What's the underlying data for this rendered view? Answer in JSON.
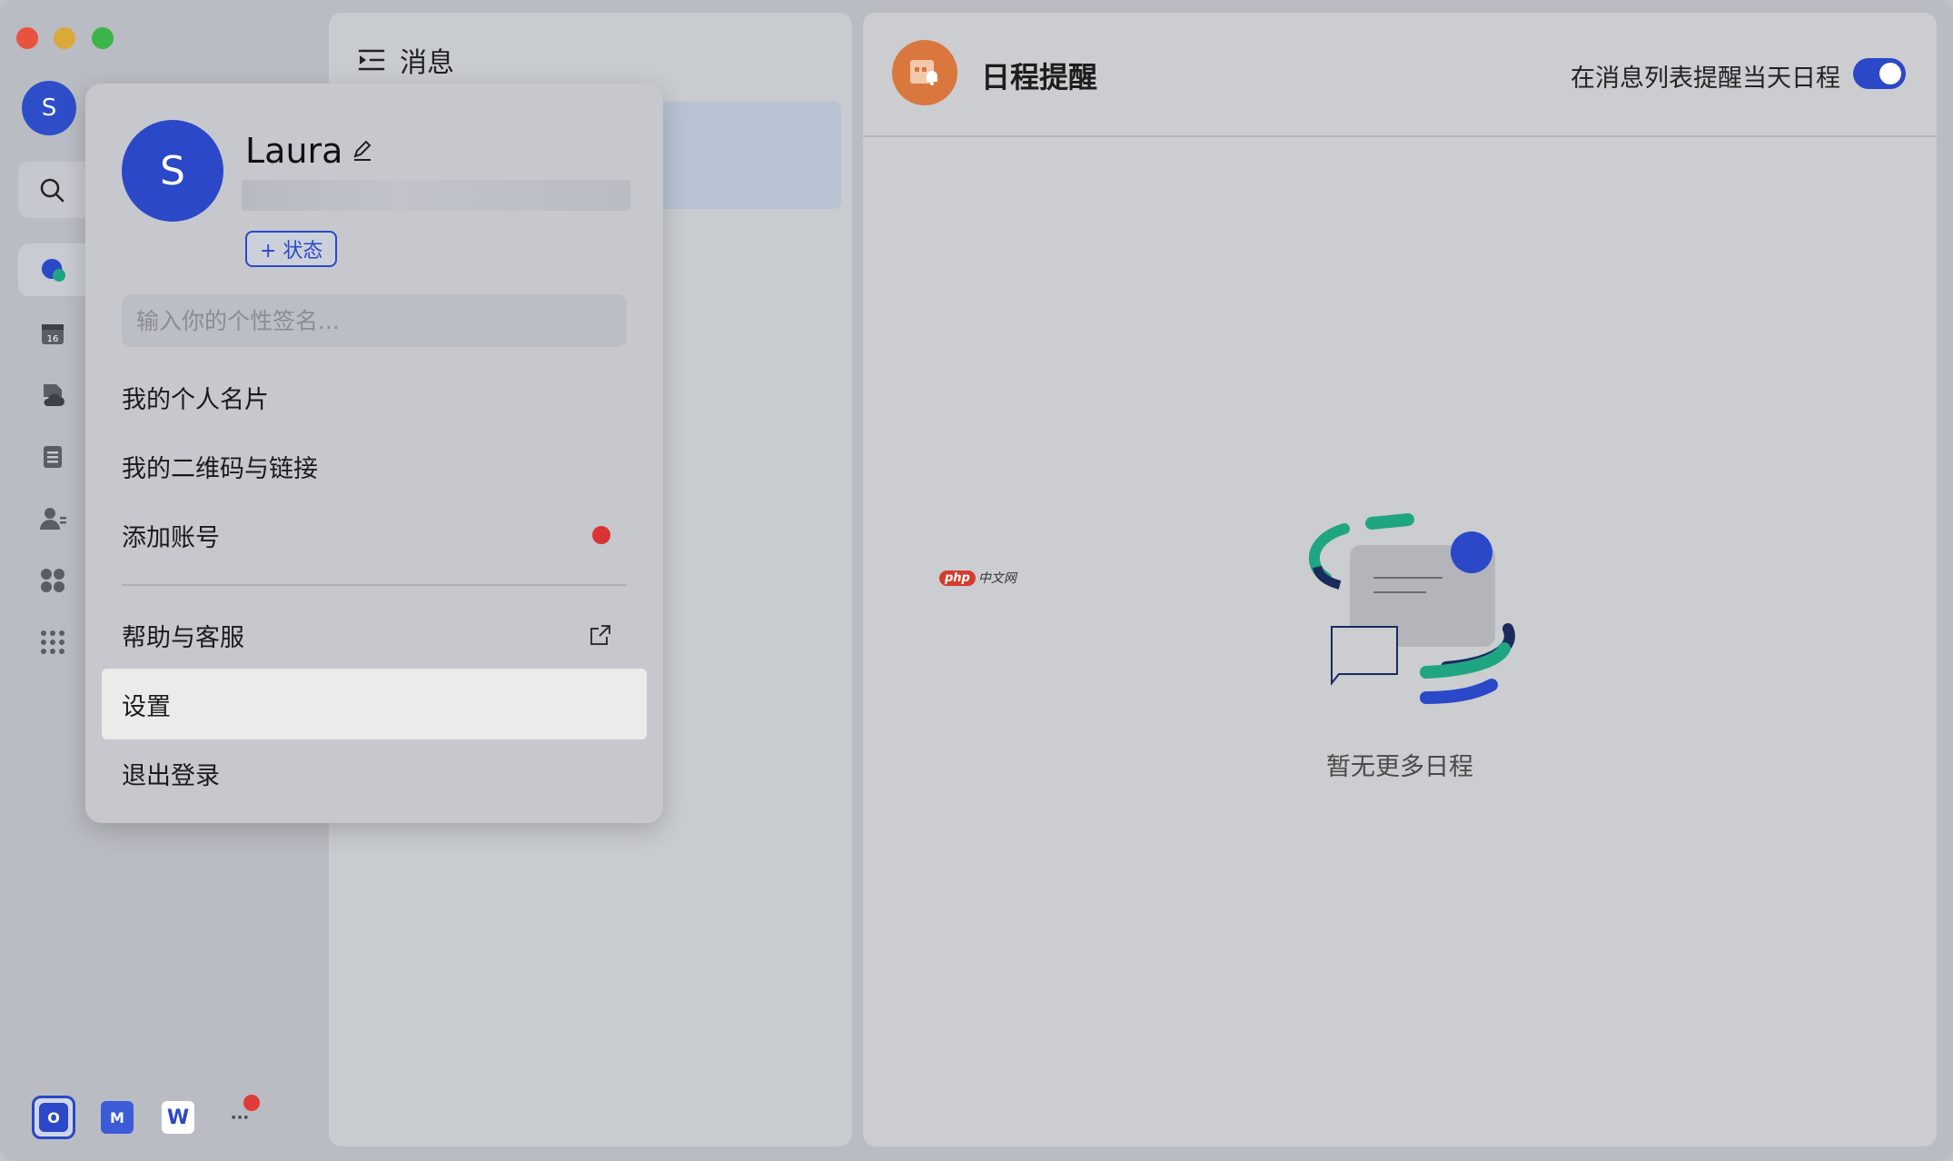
{
  "window": {
    "traffic_lights": [
      "close",
      "minimize",
      "zoom"
    ]
  },
  "rail": {
    "avatar_letter": "S",
    "items": [
      {
        "name": "messages",
        "icon": "chat-bubble-icon",
        "active": true
      },
      {
        "name": "calendar",
        "icon": "calendar-icon",
        "badge": "16"
      },
      {
        "name": "docs",
        "icon": "cloud-doc-icon"
      },
      {
        "name": "notes",
        "icon": "document-list-icon"
      },
      {
        "name": "contacts",
        "icon": "contacts-icon"
      },
      {
        "name": "workplace",
        "icon": "apps-grid-icon"
      },
      {
        "name": "more-apps",
        "icon": "dots-grid-icon"
      }
    ],
    "dock": [
      {
        "label": "O",
        "color": "#2a48c7"
      },
      {
        "label": "M",
        "color": "#3b5bd8"
      },
      {
        "label": "W",
        "color": "#2a48c7"
      },
      {
        "label": "···",
        "color": "transparent"
      }
    ]
  },
  "middle": {
    "title": "消息"
  },
  "right": {
    "title": "日程提醒",
    "toggle_label": "在消息列表提醒当天日程",
    "toggle_on": true,
    "empty_text": "暂无更多日程",
    "watermark": "中文网",
    "watermark_badge": "php",
    "colors": {
      "accent": "#2a48c7",
      "teal": "#20a583",
      "navy": "#1b2a5c",
      "orange": "#d9773e"
    }
  },
  "popup": {
    "avatar_letter": "S",
    "name": "Laura",
    "status_button": "+ 状态",
    "signature_placeholder": "输入你的个性签名...",
    "menu": {
      "card": "我的个人名片",
      "qrcode": "我的二维码与链接",
      "add_account": "添加账号",
      "help": "帮助与客服",
      "settings": "设置",
      "logout": "退出登录"
    }
  }
}
